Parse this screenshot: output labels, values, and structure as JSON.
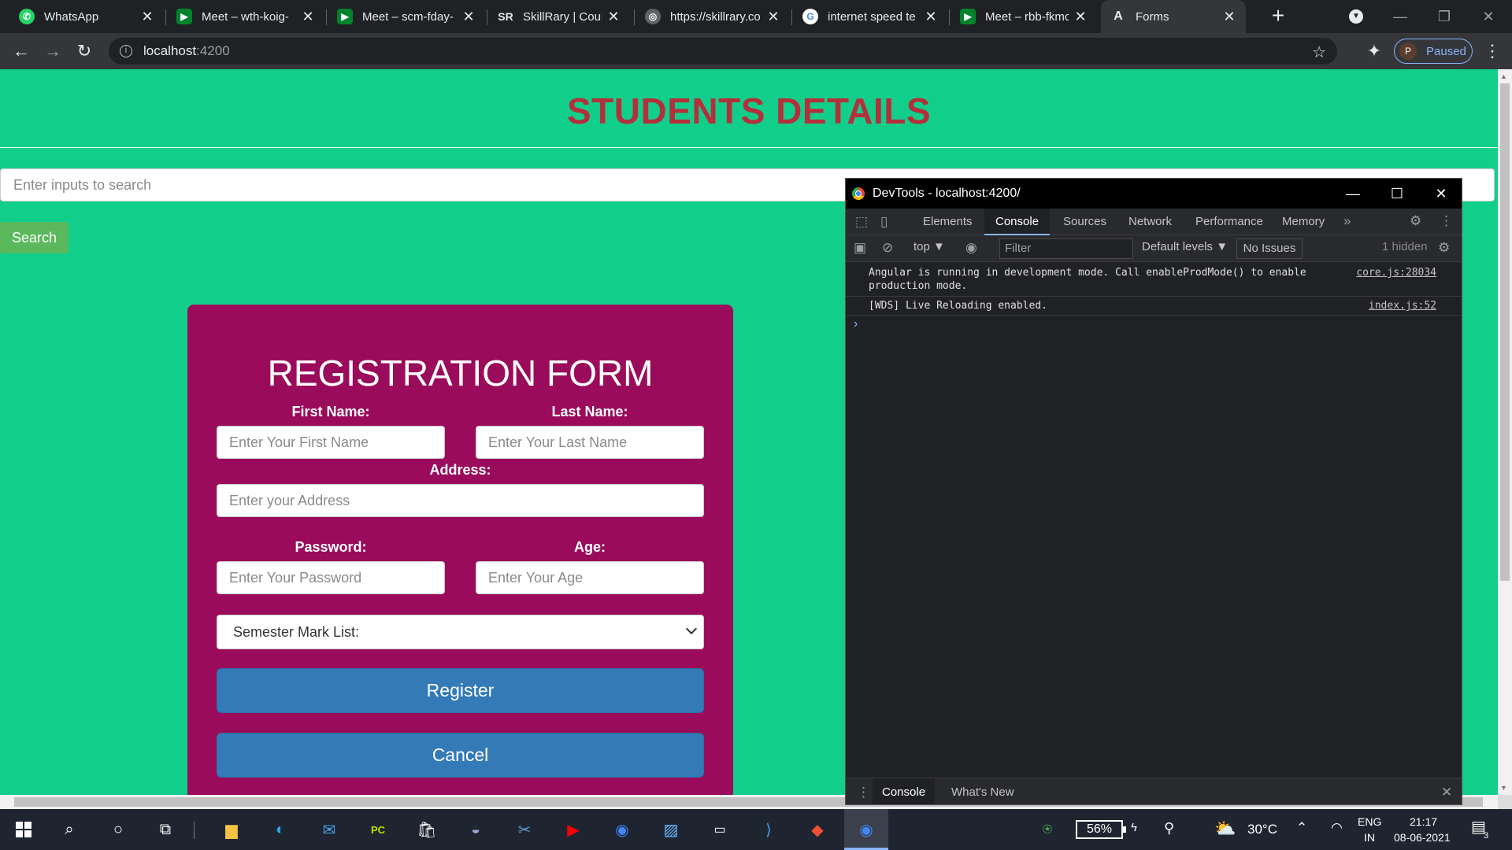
{
  "browser": {
    "tabs": [
      {
        "title": "WhatsApp",
        "icon": "whatsapp-icon",
        "color": "#25d366"
      },
      {
        "title": "Meet – wth-koig-",
        "icon": "google-meet-icon",
        "color": "#00832d"
      },
      {
        "title": "Meet – scm-fday-",
        "icon": "google-meet-icon",
        "color": "#00832d"
      },
      {
        "title": "SkillRary | Course",
        "icon": "skillrary-icon",
        "color": "#2d3e91"
      },
      {
        "title": "https://skillrary.co",
        "icon": "globe-icon",
        "color": "#5f6368"
      },
      {
        "title": "internet speed te",
        "icon": "google-icon",
        "color": "#4285f4"
      },
      {
        "title": "Meet – rbb-fkmc-",
        "icon": "google-meet-icon",
        "color": "#00832d"
      },
      {
        "title": "Forms",
        "icon": "angular-icon",
        "color": "#dd0031",
        "active": true
      }
    ],
    "url_host": "localhost",
    "url_port": ":4200",
    "profile_initial": "P",
    "profile_status": "Paused"
  },
  "page": {
    "title": "STUDENTS DETAILS",
    "search_placeholder": "Enter inputs to search",
    "search_button": "Search",
    "form": {
      "title": "REGISTRATION FORM",
      "first_name_label": "First Name:",
      "first_name_placeholder": "Enter Your First Name",
      "last_name_label": "Last Name:",
      "last_name_placeholder": "Enter Your Last Name",
      "address_label": "Address:",
      "address_placeholder": "Enter your Address",
      "password_label": "Password:",
      "password_placeholder": "Enter Your Password",
      "age_label": "Age:",
      "age_placeholder": "Enter Your Age",
      "semester_select": "Semester Mark List:",
      "register_button": "Register",
      "cancel_button": "Cancel"
    },
    "colors": {
      "background": "#11cf8b",
      "title": "#b3303b",
      "card": "#9a0c5b",
      "primary_button": "#337ab7",
      "search_button": "#5cb85c"
    }
  },
  "devtools": {
    "window_title": "DevTools - localhost:4200/",
    "tabs": [
      "Elements",
      "Console",
      "Sources",
      "Network",
      "Performance",
      "Memory"
    ],
    "active_tab": "Console",
    "more_tabs": "»",
    "context": "top ▼",
    "filter_placeholder": "Filter",
    "levels": "Default levels ▼",
    "issues": "No Issues",
    "hidden": "1 hidden",
    "messages": [
      {
        "line1": "Angular is running in development mode. Call enableProdMode() to enable",
        "line2": "production mode.",
        "source": "core.js:28034"
      },
      {
        "line1": "[WDS] Live Reloading enabled.",
        "line2": "",
        "source": "index.js:52"
      }
    ],
    "drawer_tabs": [
      "Console",
      "What's New"
    ]
  },
  "taskbar": {
    "battery": "56%",
    "temperature": "30°C",
    "language_1": "ENG",
    "language_2": "IN",
    "time": "21:17",
    "date": "08-06-2021",
    "notification_count": "3"
  }
}
